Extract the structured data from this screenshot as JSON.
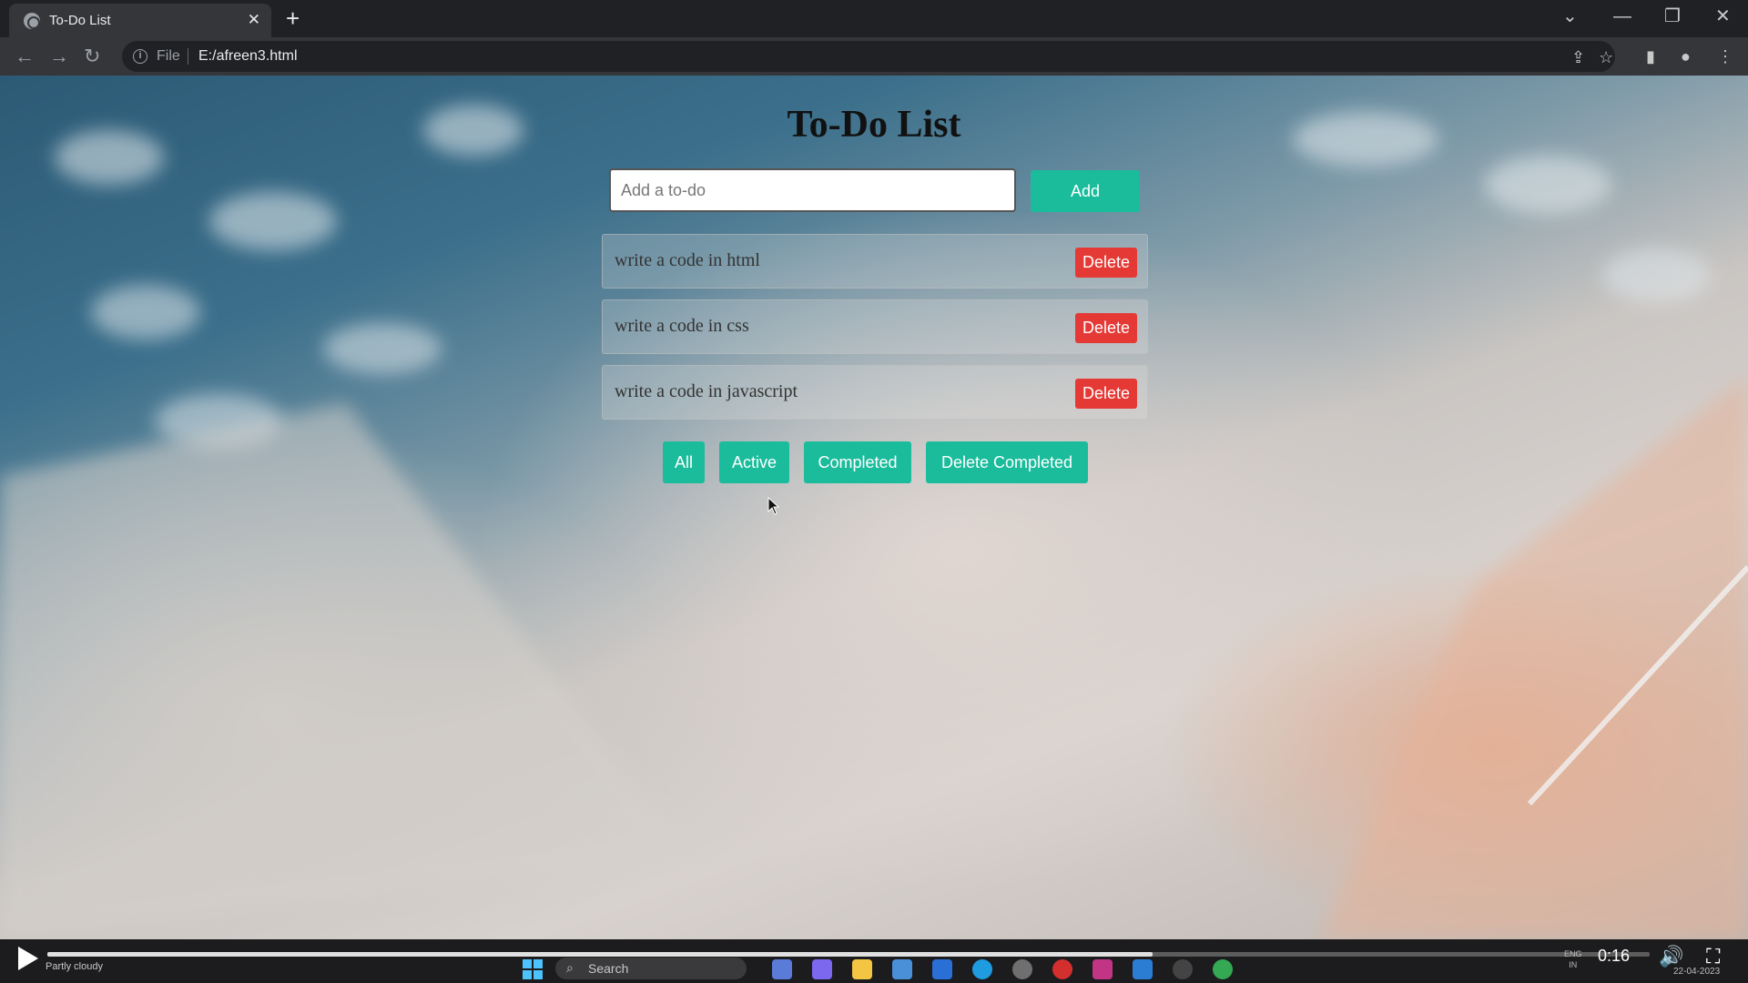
{
  "browser": {
    "tab_title": "To-Do List",
    "tab_close": "✕",
    "new_tab": "+",
    "scheme": "File",
    "url": "E:/afreen3.html",
    "controls": {
      "minimize": "—",
      "restore": "❐",
      "close": "✕",
      "tab_search": "⌄"
    }
  },
  "page": {
    "title": "To-Do List",
    "input_placeholder": "Add a to-do",
    "input_value": "",
    "add_label": "Add",
    "todos": [
      {
        "text": "write a code in html",
        "delete_label": "Delete"
      },
      {
        "text": "write a code in css",
        "delete_label": "Delete"
      },
      {
        "text": "write a code in javascript",
        "delete_label": "Delete"
      }
    ],
    "filters": {
      "all": "All",
      "active": "Active",
      "completed": "Completed",
      "delete_completed": "Delete Completed"
    }
  },
  "player": {
    "time": "0:16",
    "progress_fraction": 0.69,
    "weather": "Partly cloudy",
    "search": "Search",
    "lang": "ENG",
    "region": "IN",
    "date": "22-04-2023"
  },
  "colors": {
    "accent": "#1abc9c",
    "danger": "#e53935"
  }
}
